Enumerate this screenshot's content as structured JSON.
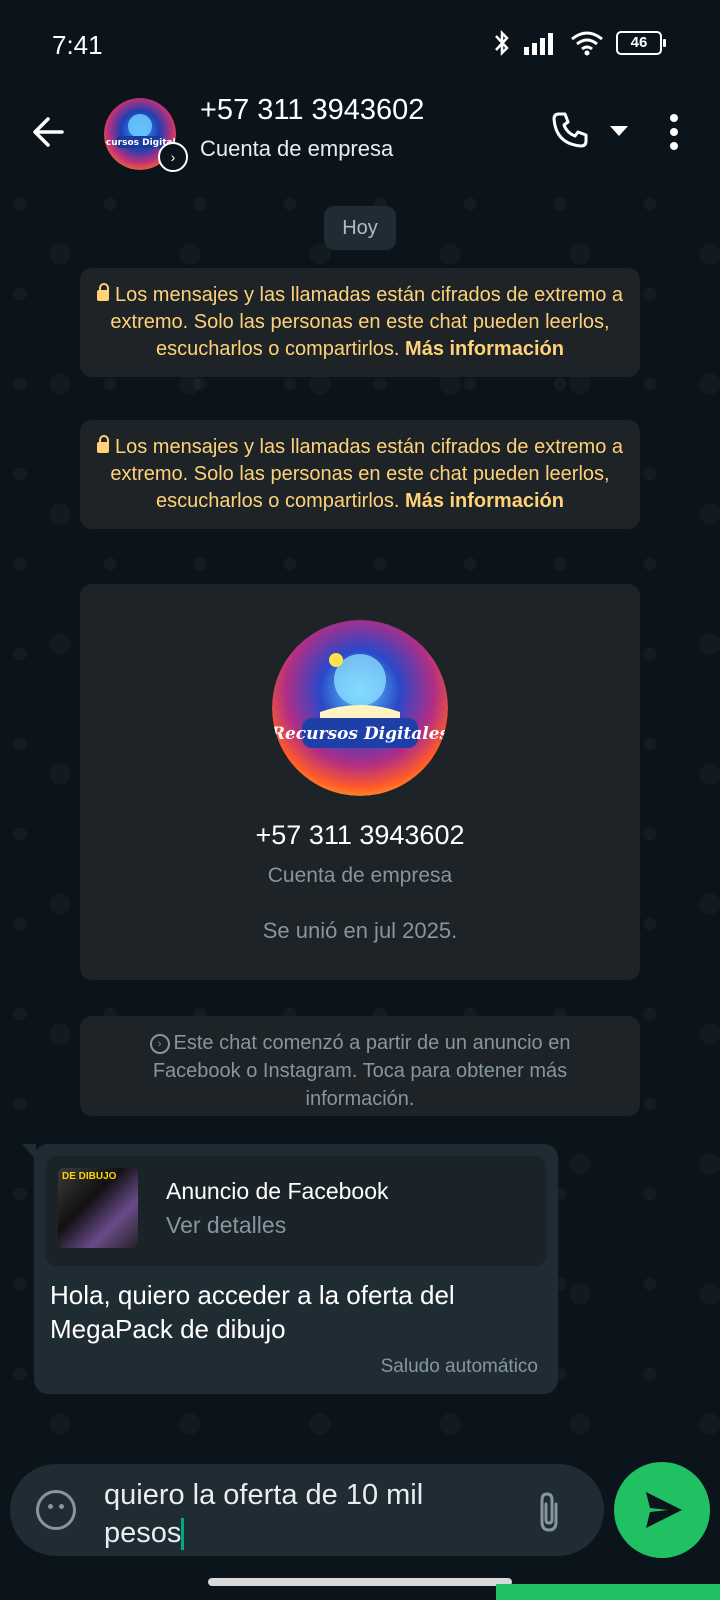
{
  "status_bar": {
    "time": "7:41",
    "battery": "46"
  },
  "header": {
    "contact_name": "+57 311 3943602",
    "contact_subtitle": "Cuenta de empresa",
    "avatar_logo_text": "Recursos Digitales"
  },
  "chat": {
    "date_chip": "Hoy",
    "encryption_notice": {
      "text": "Los mensajes y las llamadas están cifrados de extremo a extremo. Solo las personas en este chat pueden leerlos, escucharlos o compartirlos.",
      "link": "Más información"
    },
    "profile_card": {
      "number": "+57 311 3943602",
      "subtitle": "Cuenta de empresa",
      "joined": "Se unió en jul 2025."
    },
    "ad_notice": "Este chat comenzó a partir de un anuncio en Facebook o Instagram. Toca para obtener más información.",
    "message": {
      "ad_preview_title": "Anuncio de Facebook",
      "ad_preview_link": "Ver detalles",
      "ad_thumb_text": "DE DIBUJO",
      "text": "Hola, quiero acceder a la oferta del MegaPack de dibujo",
      "meta": "Saludo automático"
    }
  },
  "composer": {
    "input_value": "quiero la oferta de 10 mil pesos"
  },
  "colors": {
    "accent": "#21c063",
    "notice": "#ffd279",
    "bubble": "#202c33"
  }
}
